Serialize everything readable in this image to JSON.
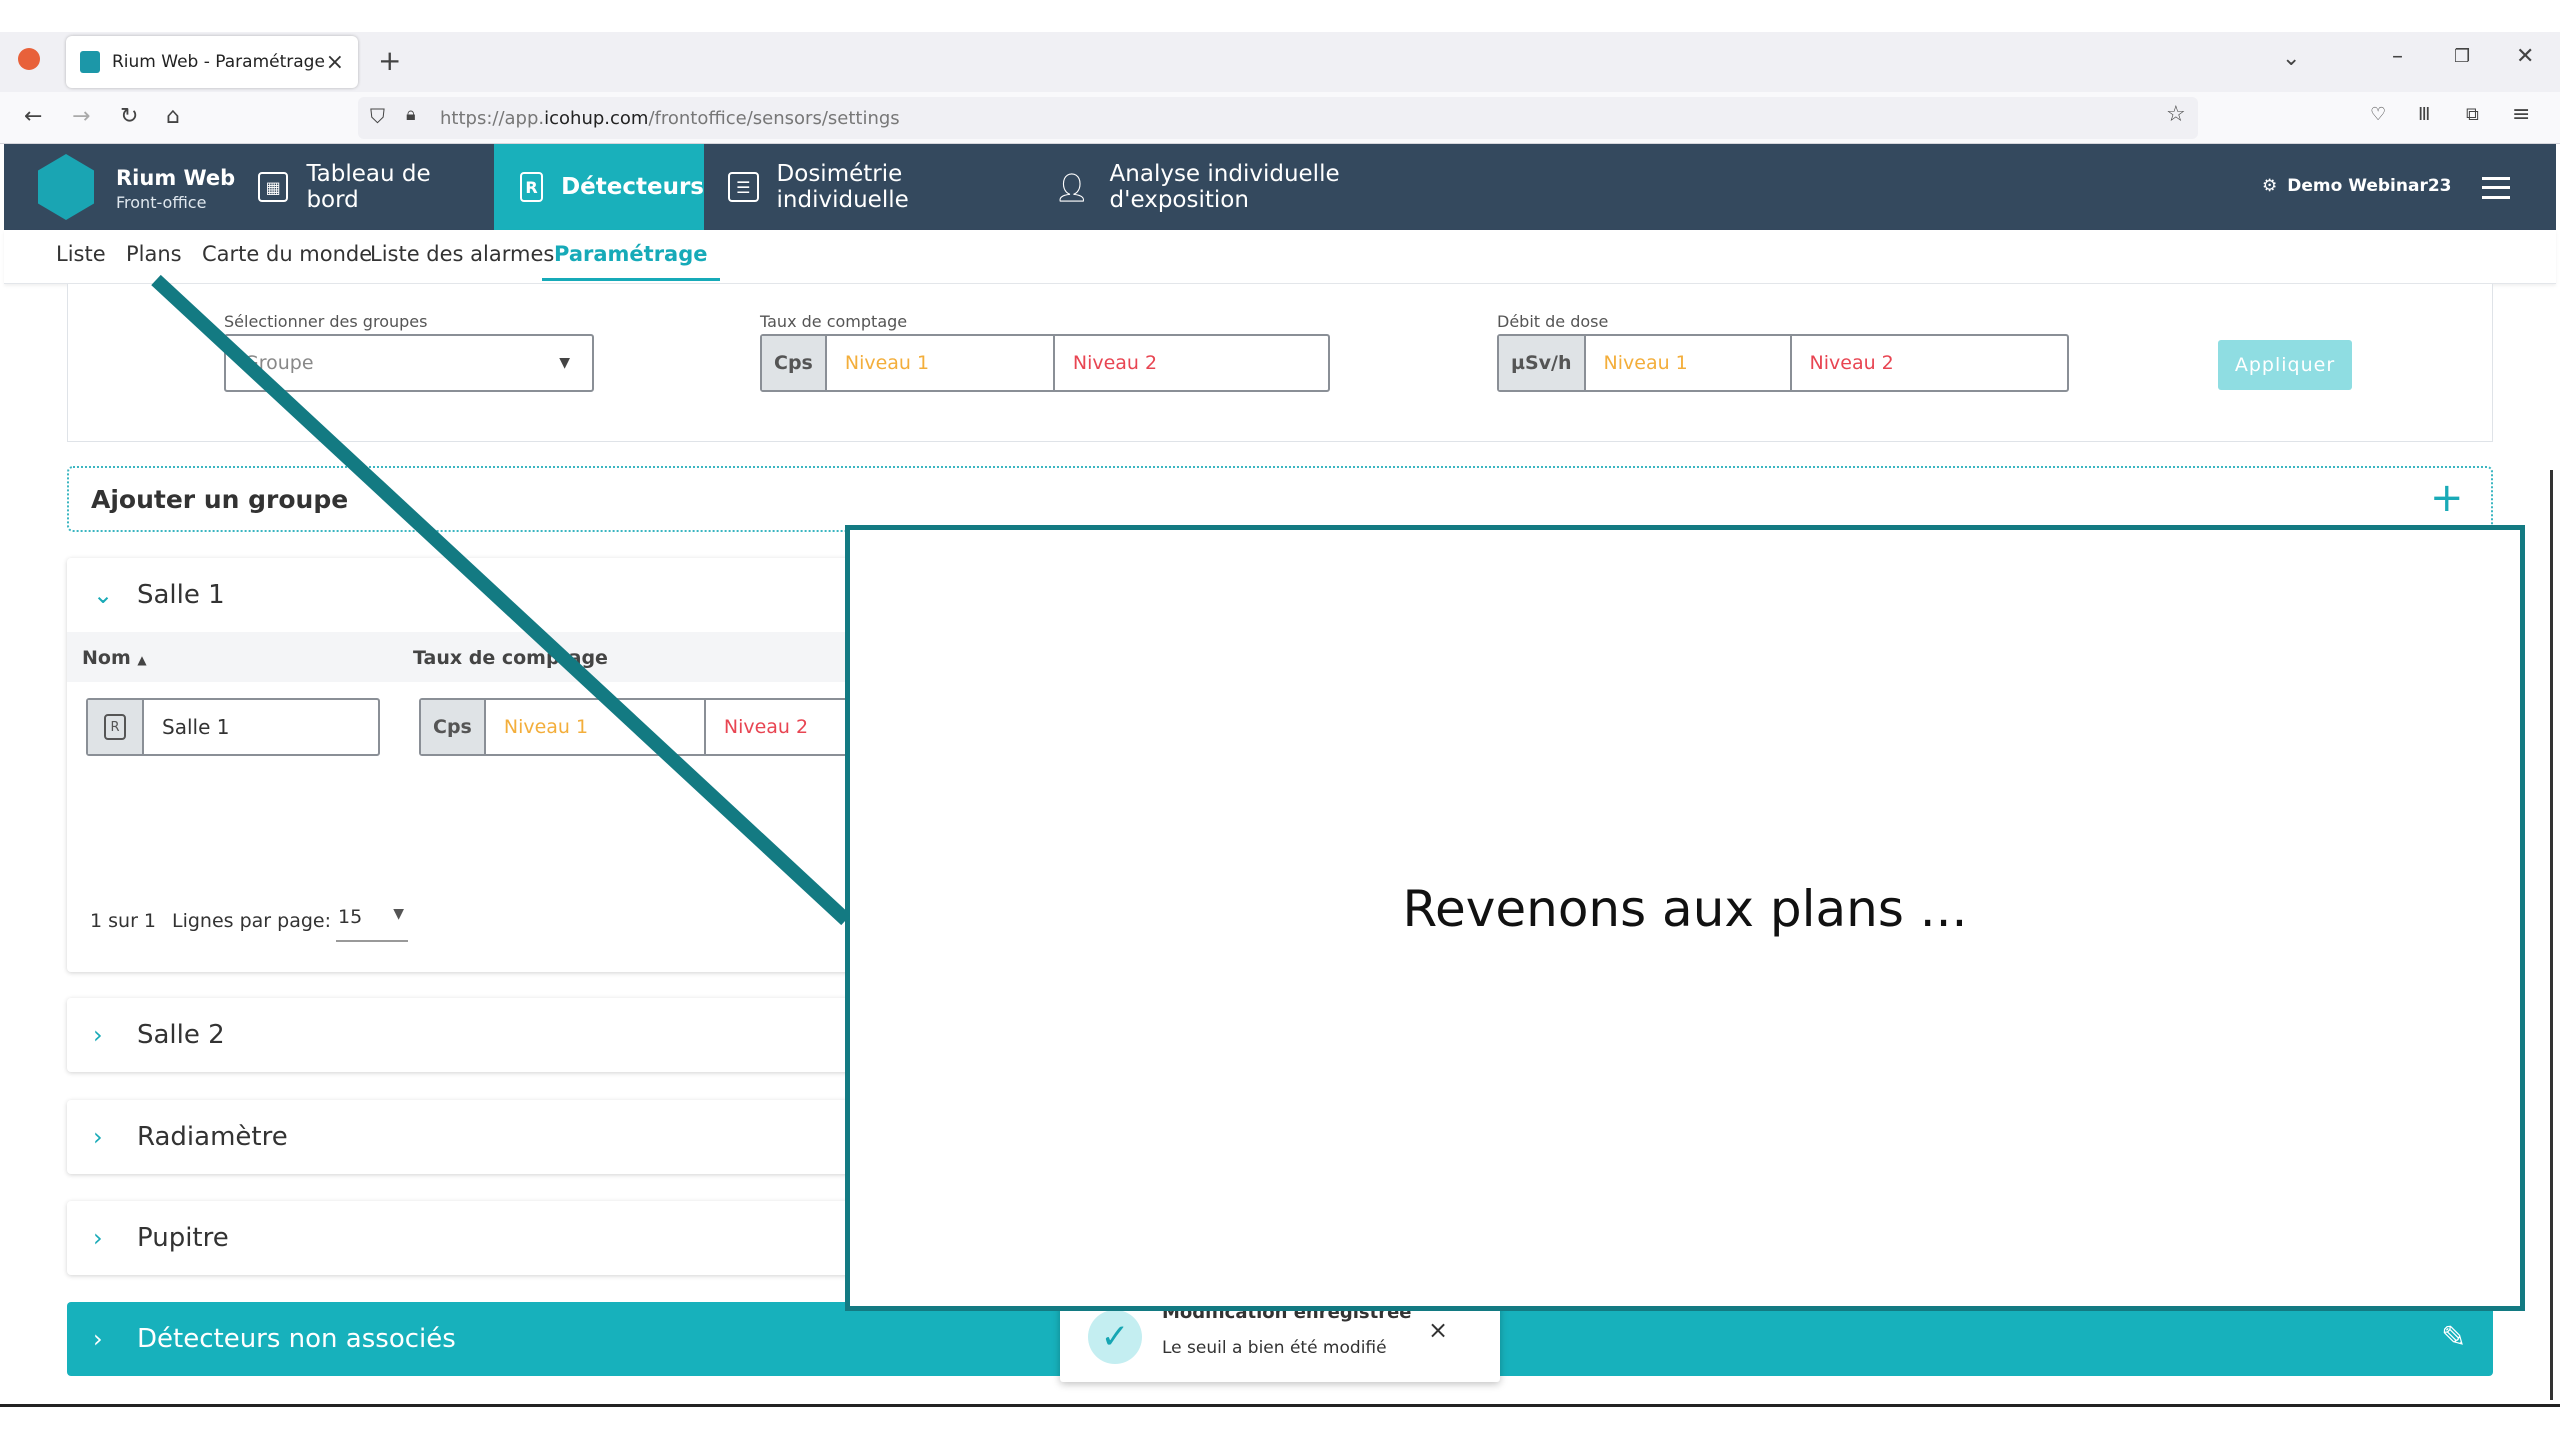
{
  "browser": {
    "tab_title": "Rium Web - Paramétrage",
    "url_prefix": "https://app.",
    "url_domain": "icohup.com",
    "url_path": "/frontoffice/sensors/settings"
  },
  "app": {
    "brand_title": "Rium Web",
    "brand_subtitle": "Front-office",
    "nav": [
      "Tableau de bord",
      "Détecteurs",
      "Dosimétrie individuelle",
      "Analyse individuelle d'exposition"
    ],
    "user": "Demo Webinar23"
  },
  "subnav": [
    "Liste",
    "Plans",
    "Carte du monde",
    "Liste des alarmes",
    "Paramétrage"
  ],
  "filters": {
    "groups_label": "Sélectionner des groupes",
    "groups_placeholder": "Groupe",
    "count_label": "Taux de comptage",
    "count_unit": "Cps",
    "dose_label": "Débit de dose",
    "dose_unit": "µSv/h",
    "level1": "Niveau 1",
    "level2": "Niveau 2",
    "apply": "Appliquer"
  },
  "add_group": "Ajouter un groupe",
  "groups": [
    {
      "name": "Salle 1",
      "expanded": true
    },
    {
      "name": "Salle 2",
      "expanded": false
    },
    {
      "name": "Radiamètre",
      "expanded": false
    },
    {
      "name": "Pupitre",
      "expanded": false
    }
  ],
  "table": {
    "col_name": "Nom",
    "col_count": "Taux de comptage",
    "row_name": "Salle 1",
    "unit": "Cps",
    "level1": "Niveau 1",
    "level2": "Niveau 2"
  },
  "pagination": {
    "range": "1 sur 1",
    "per_page_label": "Lignes par page:",
    "per_page_value": "15"
  },
  "unassigned": "Détecteurs non associés",
  "toast": {
    "title": "Modification enregistrée",
    "message": "Le seuil a bien été modifié"
  },
  "overlay": {
    "text": "Revenons aux plans ..."
  },
  "colors": {
    "header": "#34495e",
    "accent": "#19b0bb",
    "level1": "#f3ae3b",
    "level2": "#e84552",
    "overlay_border": "#137a82"
  }
}
